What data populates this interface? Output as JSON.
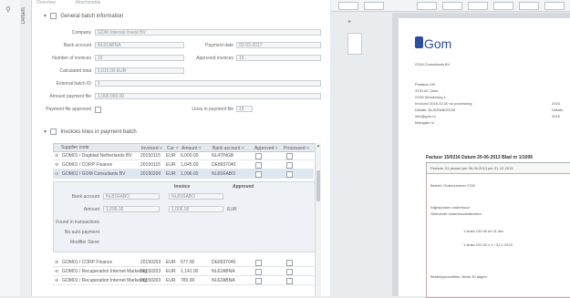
{
  "left_tabs": [
    "Overview",
    "Attachments"
  ],
  "vertical_tab_label": "Details",
  "general": {
    "header": "General batch information",
    "fields": [
      {
        "label": "Company",
        "value": "GOM Internal Invest BV"
      },
      {
        "label": "Bank account",
        "value": "NL91ABNA"
      },
      {
        "label": "Number of invoices",
        "value": "15"
      },
      {
        "label": "Calculated total",
        "value": "5,015.00 EUR"
      },
      {
        "label": "External batch ID",
        "value": "1"
      },
      {
        "label": "Amount payment file",
        "value": "1,000,000.00"
      },
      {
        "label": "Payment file approved",
        "value": ""
      }
    ],
    "right_fields": [
      {
        "label": "Payment date",
        "value": "02-03-2017"
      },
      {
        "label": "Approved invoices",
        "value": "15"
      },
      {
        "label": "Lines in payment file",
        "value": "15"
      }
    ]
  },
  "lines": {
    "header": "Invoices lines in payment batch",
    "columns": [
      "Supplier code",
      "Invoiced",
      "Cur",
      "Amount",
      "Bank account",
      "Approved",
      "Processed"
    ],
    "rows": [
      {
        "supplier": "GOM01 / Dagblad Netherlands BV",
        "invoiced": "20150115",
        "cur": "EUR",
        "amount": "6,000.00",
        "bank": "NL47INGB",
        "approved": true,
        "processed": false
      },
      {
        "supplier": "GOM01 / CORP Finance",
        "invoiced": "20150115",
        "cur": "EUR",
        "amount": "1,045.00",
        "bank": "DE8937040",
        "approved": true,
        "processed": false
      },
      {
        "supplier": "GOM01 / GOM Consultants BV",
        "invoiced": "20150200",
        "cur": "EUR",
        "amount": "1,096.00",
        "bank": "NL81RABO",
        "approved": true,
        "processed": false
      }
    ],
    "rows_below": [
      {
        "supplier": "GOM01 / CORP Finance",
        "invoiced": "20150203",
        "cur": "EUR",
        "amount": "677.00",
        "bank": "DE8937040",
        "approved": true,
        "processed": false
      },
      {
        "supplier": "GOM01 / Recuperation Internet Marketing",
        "invoiced": "20150203",
        "cur": "EUR",
        "amount": "1,141.00",
        "bank": "NL62ABNA",
        "approved": true,
        "processed": false
      },
      {
        "supplier": "GOM01 / Recuperation Internet Marketing",
        "invoiced": "20150203",
        "cur": "EUR",
        "amount": "783.00",
        "bank": "NL62ABNA",
        "approved": true,
        "processed": false
      }
    ]
  },
  "detail": {
    "col_invoice": "Invoice",
    "col_approved": "Approved",
    "bank_label": "Bank account",
    "bank_val1": "NL81RABO",
    "bank_val2": "NL81RABO",
    "amount_label": "Amount",
    "amount_val1": "1,096.00",
    "amount_val2": "1,096.00",
    "cur": "EUR",
    "found_label": "Found in transactions",
    "no_auto_label": "No auto payment",
    "modifier_label": "Modifier Steve"
  },
  "document": {
    "brand": "Gom",
    "addr_lines": [
      "GOM Consultants BV",
      "Postbus 100",
      "3700 AC Zeist",
      "GOM Westerweg 1",
      "Invoiced 2015-02-00 no processing",
      "Details: NL81RABO0199",
      "info@gom.nl",
      "Maingate nl"
    ],
    "right_lines": [
      "2015",
      "Details",
      "2015"
    ],
    "factuur": "Factuur  15/0216   Datum  20-06-2013   Blad nr  1/1006",
    "band_text": "Periode: 01 januari per 06-06-2013 per 31-12-2013",
    "body_lines": [
      "Betreft: Ordernummer 1700",
      ""
    ],
    "notes": [
      "Afgesproken onderhoud",
      "Geleverde onderhoudsdiensten",
      "1 stuks 100.00 tot 11 dec",
      "1 stuks 120.00 x 1 / 31-1 2015",
      "Betalingscondities: Netto 30 dagen"
    ]
  },
  "icons": {
    "gutter": "search-icon",
    "collapse": "chevron-down-icon",
    "filter": "filter-icon"
  }
}
